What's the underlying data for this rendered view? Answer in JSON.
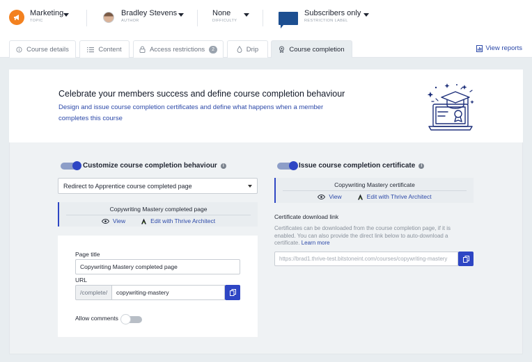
{
  "meta": {
    "topic": {
      "value": "Marketing",
      "label": "TOPIC"
    },
    "author": {
      "value": "Bradley Stevens",
      "label": "AUTHOR"
    },
    "difficulty": {
      "value": "None",
      "label": "DIFFICULTY"
    },
    "restriction": {
      "value": "Subscribers only",
      "label": "RESTRICTION LABEL"
    }
  },
  "tabs": [
    {
      "label": "Course details",
      "icon": "info-icon"
    },
    {
      "label": "Content",
      "icon": "list-icon"
    },
    {
      "label": "Access restrictions",
      "icon": "lock-icon",
      "badge": "2"
    },
    {
      "label": "Drip",
      "icon": "drop-icon"
    },
    {
      "label": "Course completion",
      "icon": "award-icon",
      "active": true
    }
  ],
  "view_reports": "View reports",
  "hero": {
    "title": "Celebrate your members success and define course completion behaviour",
    "subtitle": "Design and issue course completion certificates and define what happens when a member completes this course"
  },
  "behaviour": {
    "title": "Customize course completion behaviour",
    "enabled": true,
    "dropdown_value": "Redirect to Apprentice course completed page",
    "page_name": "Copywriting Mastery completed page",
    "view_label": "View",
    "edit_label": "Edit with Thrive Architect",
    "page_title_label": "Page title",
    "page_title_value": "Copywriting Mastery completed page",
    "url_label": "URL",
    "url_prefix": "/complete/",
    "url_slug": "copywriting-mastery",
    "allow_comments_label": "Allow comments",
    "allow_comments": false
  },
  "certificate": {
    "title": "Issue course completion certificate",
    "enabled": true,
    "name": "Copywriting Mastery certificate",
    "view_label": "View",
    "edit_label": "Edit with Thrive Architect",
    "download_label": "Certificate download link",
    "help_text": "Certificates can be downloaded from the course completion page, if it is enabled. You can also provide the direct link below to auto-download a certificate.",
    "learn_more": "Learn more",
    "link_value": "https://brad1.thrive-test.bitstoneint.com/courses/copywriting-mastery"
  },
  "colors": {
    "accent": "#2e46c4",
    "link": "#2b48a8",
    "topic_orange": "#f3811f",
    "flag_blue": "#1d4f91"
  }
}
